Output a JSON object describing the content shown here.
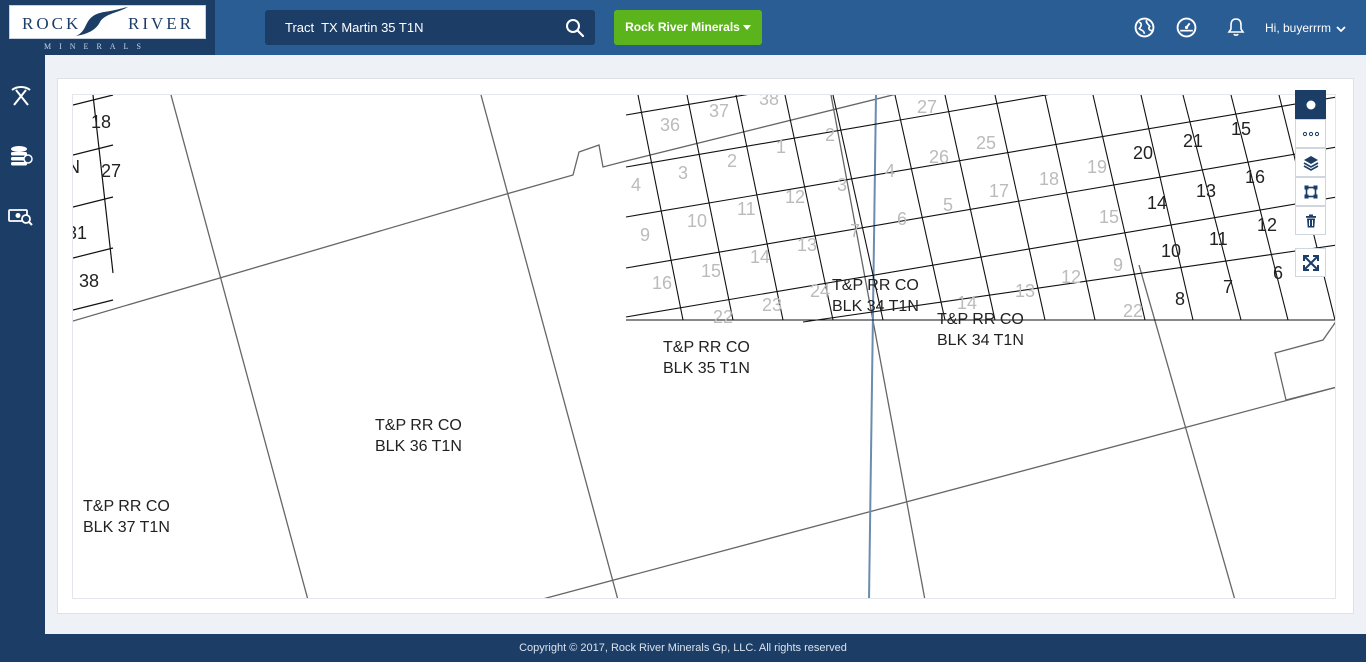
{
  "header": {
    "logo": {
      "word1": "ROCK",
      "word2": "RIVER",
      "sub": "MINERALS"
    },
    "search": {
      "value": "Tract  TX Martin 35 T1N"
    },
    "account_button": "Rock River Minerals",
    "user_greeting": "Hi, buyerrrm",
    "icons": [
      "globe-icon",
      "dashboard-gauge-icon",
      "bell-icon",
      "chevron-down-icon"
    ]
  },
  "sidebar": {
    "items": [
      {
        "icon": "pickaxe-icon"
      },
      {
        "icon": "coin-stack-icon"
      },
      {
        "icon": "cash-search-icon"
      }
    ]
  },
  "map": {
    "block_labels": [
      {
        "line1": "T&P RR CO",
        "line2": "BLK 37 T1N"
      },
      {
        "line1": "T&P RR CO",
        "line2": "BLK 36 T1N"
      },
      {
        "line1": "T&P RR CO",
        "line2": "BLK 35 T1N"
      },
      {
        "line1": "T&P RR CO",
        "line2": "BLK 34 T1N"
      },
      {
        "line1": "T&P RR CO",
        "line2": "BLK 34 T1N"
      }
    ],
    "section_numbers_left": [
      "18",
      "27",
      "38",
      "31",
      "N"
    ],
    "section_numbers_grid": [
      "37",
      "38",
      "36",
      "1",
      "2",
      "4",
      "3",
      "2",
      "4",
      "10",
      "11",
      "12",
      "3",
      "9",
      "15",
      "14",
      "13",
      "7",
      "16",
      "22",
      "23",
      "24",
      "27",
      "26",
      "25",
      "5",
      "6",
      "17",
      "18",
      "19",
      "20",
      "21",
      "15",
      "14",
      "13",
      "16",
      "10",
      "11",
      "12",
      "15",
      "14",
      "13",
      "12",
      "9",
      "8",
      "7",
      "6",
      "22",
      "23",
      "24",
      "22"
    ],
    "tools": [
      "point-tool-icon",
      "line-tool-icon",
      "layers-icon",
      "polygon-tool-icon",
      "trash-icon",
      "fullscreen-icon"
    ]
  },
  "footer": {
    "copyright": "Copyright © 2017, Rock River Minerals Gp, LLC. All rights reserved"
  },
  "colors": {
    "header": "#2a5d94",
    "dark": "#1c3d66",
    "accent": "#5cb41d"
  }
}
